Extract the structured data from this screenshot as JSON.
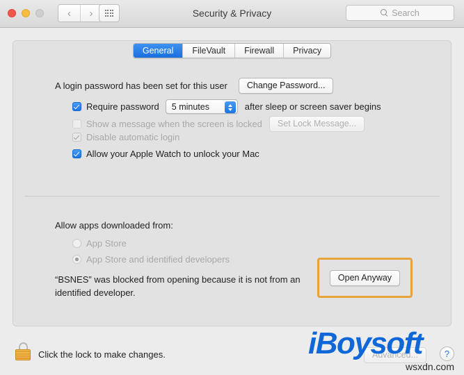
{
  "window": {
    "title": "Security & Privacy",
    "traffic_lights": [
      "close",
      "minimize",
      "zoom"
    ],
    "back_icon": "chevron-left-icon",
    "forward_icon": "chevron-right-icon",
    "show_all_icon": "grid-icon"
  },
  "search": {
    "placeholder": "Search",
    "icon": "search-icon"
  },
  "tabs": [
    {
      "label": "General",
      "active": true
    },
    {
      "label": "FileVault",
      "active": false
    },
    {
      "label": "Firewall",
      "active": false
    },
    {
      "label": "Privacy",
      "active": false
    }
  ],
  "general": {
    "login_password_text": "A login password has been set for this user",
    "change_password_label": "Change Password...",
    "require_password_label": "Require password",
    "require_password_value": "5 minutes",
    "require_password_suffix": "after sleep or screen saver begins",
    "show_message_label": "Show a message when the screen is locked",
    "set_lock_message_label": "Set Lock Message...",
    "disable_auto_login_label": "Disable automatic login",
    "apple_watch_label": "Allow your Apple Watch to unlock your Mac"
  },
  "downloads": {
    "heading": "Allow apps downloaded from:",
    "options": [
      {
        "label": "App Store",
        "selected": false
      },
      {
        "label": "App Store and identified developers",
        "selected": true
      }
    ],
    "blocked_message": "“BSNES” was blocked from opening because it is not from an identified developer.",
    "open_anyway_label": "Open Anyway"
  },
  "bottom": {
    "lock_icon": "lock-closed-icon",
    "lock_text": "Click the lock to make changes.",
    "advanced_label": "Advanced...",
    "help_label": "?"
  },
  "watermark": {
    "brand": "iBoysoft",
    "site": "wsxdn.com"
  },
  "colors": {
    "accent_blue": "#1a74e2",
    "annotation_orange": "#e8a33d",
    "lock_gold": "#e09b2e",
    "brand_blue": "#1068d8"
  }
}
